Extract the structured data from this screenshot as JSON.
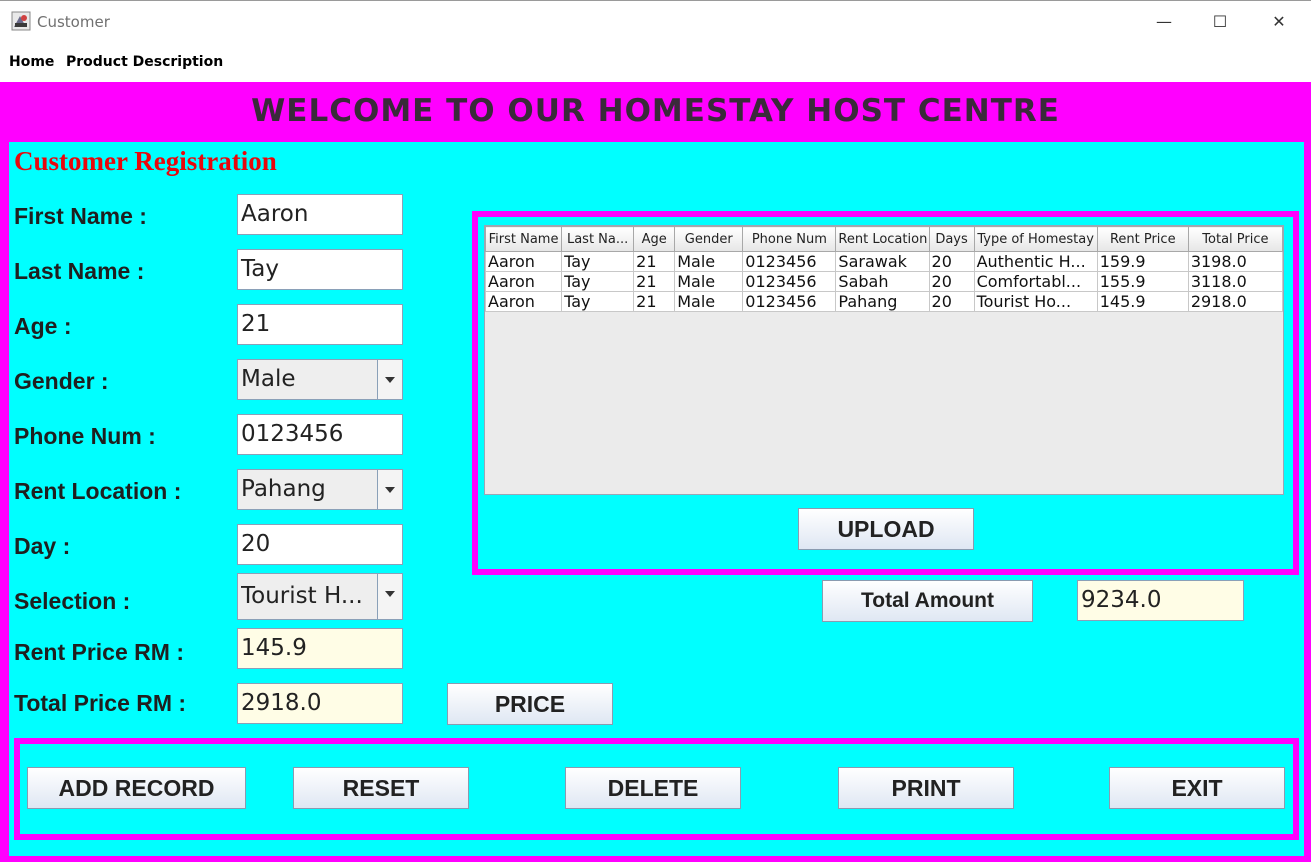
{
  "window": {
    "title": "Customer",
    "minimize": "—",
    "maximize": "☐",
    "close": "✕"
  },
  "menu": [
    "Home",
    "Product Description"
  ],
  "header": "WELCOME TO OUR HOMESTAY HOST CENTRE",
  "form": {
    "title": "Customer Registration",
    "first_name": {
      "label": "First Name :",
      "value": "Aaron"
    },
    "last_name": {
      "label": "Last Name :",
      "value": "Tay"
    },
    "age": {
      "label": "Age :",
      "value": "21"
    },
    "gender": {
      "label": "Gender :",
      "value": "Male"
    },
    "phone": {
      "label": "Phone Num :",
      "value": "0123456"
    },
    "location": {
      "label": "Rent Location :",
      "value": "Pahang"
    },
    "day": {
      "label": "Day :",
      "value": "20"
    },
    "selection": {
      "label": "Selection :",
      "value": "Tourist H..."
    },
    "rent_price": {
      "label": "Rent Price RM :",
      "value": "145.9"
    },
    "total_price": {
      "label": "Total Price RM :",
      "value": "2918.0"
    },
    "price_button": "PRICE"
  },
  "table": {
    "columns": [
      "First Name",
      "Last Na...",
      "Age",
      "Gender",
      "Phone Num",
      "Rent Location",
      "Days",
      "Type of Homestay",
      "Rent Price",
      "Total Price"
    ],
    "rows": [
      [
        "Aaron",
        "Tay",
        "21",
        "Male",
        "0123456",
        "Sarawak",
        "20",
        "Authentic H...",
        "159.9",
        "3198.0"
      ],
      [
        "Aaron",
        "Tay",
        "21",
        "Male",
        "0123456",
        "Sabah",
        "20",
        "Comfortabl...",
        "155.9",
        "3118.0"
      ],
      [
        "Aaron",
        "Tay",
        "21",
        "Male",
        "0123456",
        "Pahang",
        "20",
        "Tourist Ho...",
        "145.9",
        "2918.0"
      ]
    ]
  },
  "upload_button": "UPLOAD",
  "total_amount": {
    "label": "Total Amount",
    "value": "9234.0"
  },
  "actions": {
    "add": "ADD RECORD",
    "reset": "RESET",
    "delete": "DELETE",
    "print": "PRINT",
    "exit": "EXIT"
  },
  "colors": {
    "frame": "#ff00ff",
    "content": "#00ffff",
    "form_title": "#e8070c",
    "readonly_field": "#fffde6"
  }
}
